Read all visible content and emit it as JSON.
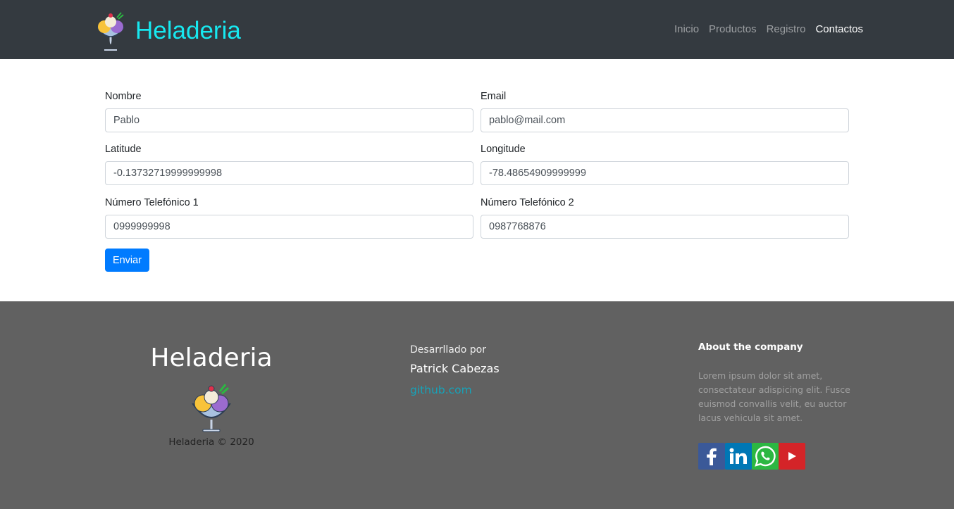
{
  "navbar": {
    "brand": "Heladeria",
    "links": [
      {
        "label": "Inicio",
        "active": false
      },
      {
        "label": "Productos",
        "active": false
      },
      {
        "label": "Registro",
        "active": false
      },
      {
        "label": "Contactos",
        "active": true
      }
    ]
  },
  "form": {
    "nombre": {
      "label": "Nombre",
      "value": "Pablo"
    },
    "email": {
      "label": "Email",
      "value": "pablo@mail.com"
    },
    "latitude": {
      "label": "Latitude",
      "value": "-0.13732719999999998"
    },
    "longitude": {
      "label": "Longitude",
      "value": "-78.48654909999999"
    },
    "telefono1": {
      "label": "Número Telefónico 1",
      "value": "0999999998"
    },
    "telefono2": {
      "label": "Número Telefónico 2",
      "value": "0987768876"
    },
    "submit_label": "Enviar"
  },
  "footer": {
    "brand": "Heladeria",
    "copyright": "Heladeria © 2020",
    "dev_label": "Desarrllado por",
    "dev_name": "Patrick Cabezas",
    "dev_link": "github.com",
    "about_title": "About the company",
    "about_text": "Lorem ipsum dolor sit amet, consectateur adispicing elit. Fusce euismod convallis velit, eu auctor lacus vehicula sit amet.",
    "socials": [
      {
        "icon": "facebook-icon",
        "color": "#3b5998"
      },
      {
        "icon": "linkedin-icon",
        "color": "#0077b5"
      },
      {
        "icon": "whatsapp-icon",
        "color": "#2cb742"
      },
      {
        "icon": "youtube-icon",
        "color": "#d42428"
      }
    ]
  },
  "colors": {
    "navbar_bg": "#343a40",
    "brand": "#17e8f0",
    "primary": "#007bff",
    "footer_bg": "#616161",
    "link": "#17a2b8"
  }
}
